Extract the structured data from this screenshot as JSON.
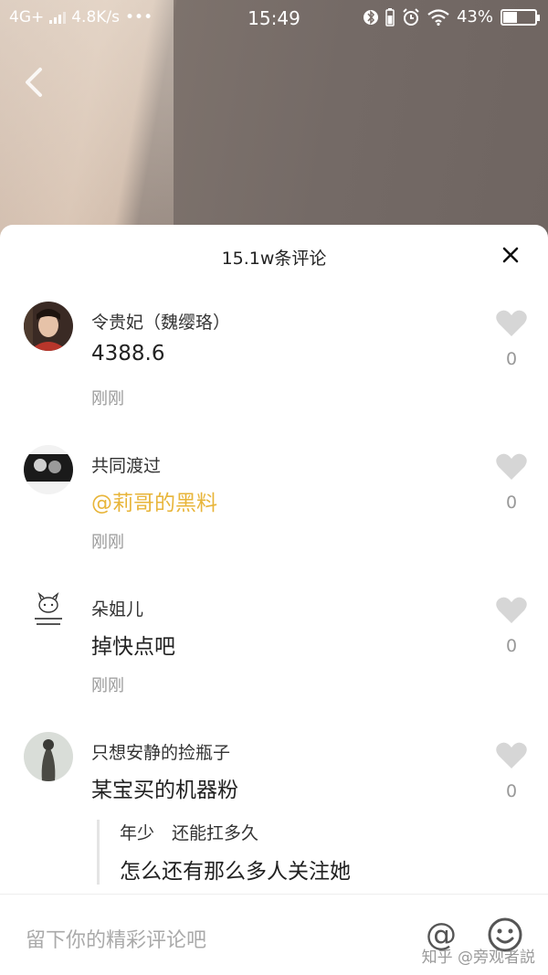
{
  "status_bar": {
    "network": "4G+",
    "speed": "4.8K/s",
    "dots": "•••",
    "time": "15:49",
    "battery": "43%",
    "battery_level": 0.43
  },
  "sheet": {
    "title": "15.1w条评论",
    "close_glyph": "✕"
  },
  "comments": [
    {
      "author": "令贵妃（魏缨珞）",
      "content": "4388.6",
      "time": "刚刚",
      "likes": "0"
    },
    {
      "author": "共同渡过",
      "content": "@莉哥的黑料",
      "time": "刚刚",
      "likes": "0"
    },
    {
      "author": "朵姐儿",
      "content": "掉快点吧",
      "time": "刚刚",
      "likes": "0"
    },
    {
      "author": "只想安静的捡瓶子",
      "content": "某宝买的机器粉",
      "likes": "0",
      "reply": {
        "author": "年少　还能扛多久",
        "content": "怎么还有那么多人关注她"
      }
    }
  ],
  "input_bar": {
    "placeholder": "留下你的精彩评论吧",
    "at_glyph": "@",
    "watermark": "知乎 @旁观者説"
  },
  "colors": {
    "mention": "#e8b53a",
    "like_icon": "#d6d6d6",
    "secondary_text": "#999999"
  },
  "icons": [
    "back-arrow-icon",
    "bluetooth-icon",
    "alarm-icon",
    "wifi-icon",
    "battery-icon",
    "close-icon",
    "heart-icon",
    "at-icon",
    "emoji-icon"
  ]
}
